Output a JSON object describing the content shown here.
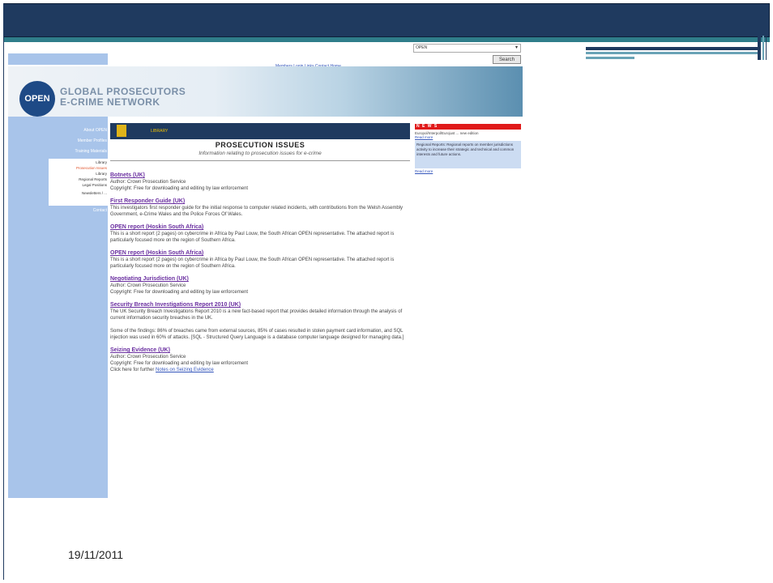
{
  "slide": {
    "date": "19/11/2011"
  },
  "site": {
    "top_links": "Members Login  Links  Contact  Home",
    "search_select_value": "OPEN",
    "search_button": "Search",
    "logo": "OPEN",
    "logo_text_line1": "GLOBAL PROSECUTORS",
    "logo_text_line2": "E-CRIME NETWORK",
    "nav": {
      "blue_items": [
        "About OPEN",
        "Member Profiles",
        "Training Materials"
      ],
      "library_items": [
        "Library",
        "Prosecution Issues",
        "Library",
        "Regional Reports",
        "Legal Positions",
        "Newsletters / ..."
      ],
      "contact": "Contact"
    },
    "section_label": "LIBRARY",
    "page_title": "PROSECUTION ISSUES",
    "page_subtitle": "Information relating to prosecution issues for e-crime",
    "articles": [
      {
        "title": "Botnets (UK)",
        "body": "Author: Crown Prosecution Service\nCopyright: Free for downloading and editing by law enforcement"
      },
      {
        "title": "First Responder Guide (UK)",
        "body": "This investigators first responder guide for the initial response to computer related incidents, with contributions from the Welsh Assembly Government, e-Crime Wales and the Police Forces Of Wales."
      },
      {
        "title": "OPEN report (Hoskin South Africa)",
        "body": "This is a short report (2 pages) on cybercrime in Africa by Paul Louw, the South African OPEN representative. The attached report is particularly focused more on the region of Southern Africa."
      },
      {
        "title": "OPEN report (Hoskin South Africa)",
        "body": "This is a short report (2 pages) on cybercrime in Africa by Paul Louw, the South African OPEN representative. The attached report is particularly focused more on the region of Southern Africa."
      },
      {
        "title": "Negotiating Jurisdiction (UK)",
        "body": "Author: Crown Prosecution Service\nCopyright: Free for downloading and editing by law enforcement"
      },
      {
        "title": "Security Breach Investigations Report 2010 (UK)",
        "body": "The UK Security Breach Investigations Report 2010 is a new fact-based report that provides detailed information through the analysis of current information security breaches in the UK.\n\nSome of the findings: 86% of breaches came from external sources, 85% of cases resulted in stolen payment card information, and SQL injection was used in 60% of attacks. [SQL - Structured Query Language is a database computer language designed for managing data.]"
      },
      {
        "title": "Seizing Evidence (UK)",
        "body": "Author: Crown Prosecution Service\nCopyright: Free for downloading and editing by law enforcement\nClick here for further",
        "link": "Notes on Seizing Evidence"
      }
    ],
    "news": {
      "header": "N E W S",
      "line1": "Europol/Interpol/Eurojust ... new edition",
      "more1": "Read more",
      "box": "Regional Reports: Regional reports on member jurisdictions activity to increase their strategic and technical and common interests and future actions.",
      "more2": "Read more"
    }
  }
}
